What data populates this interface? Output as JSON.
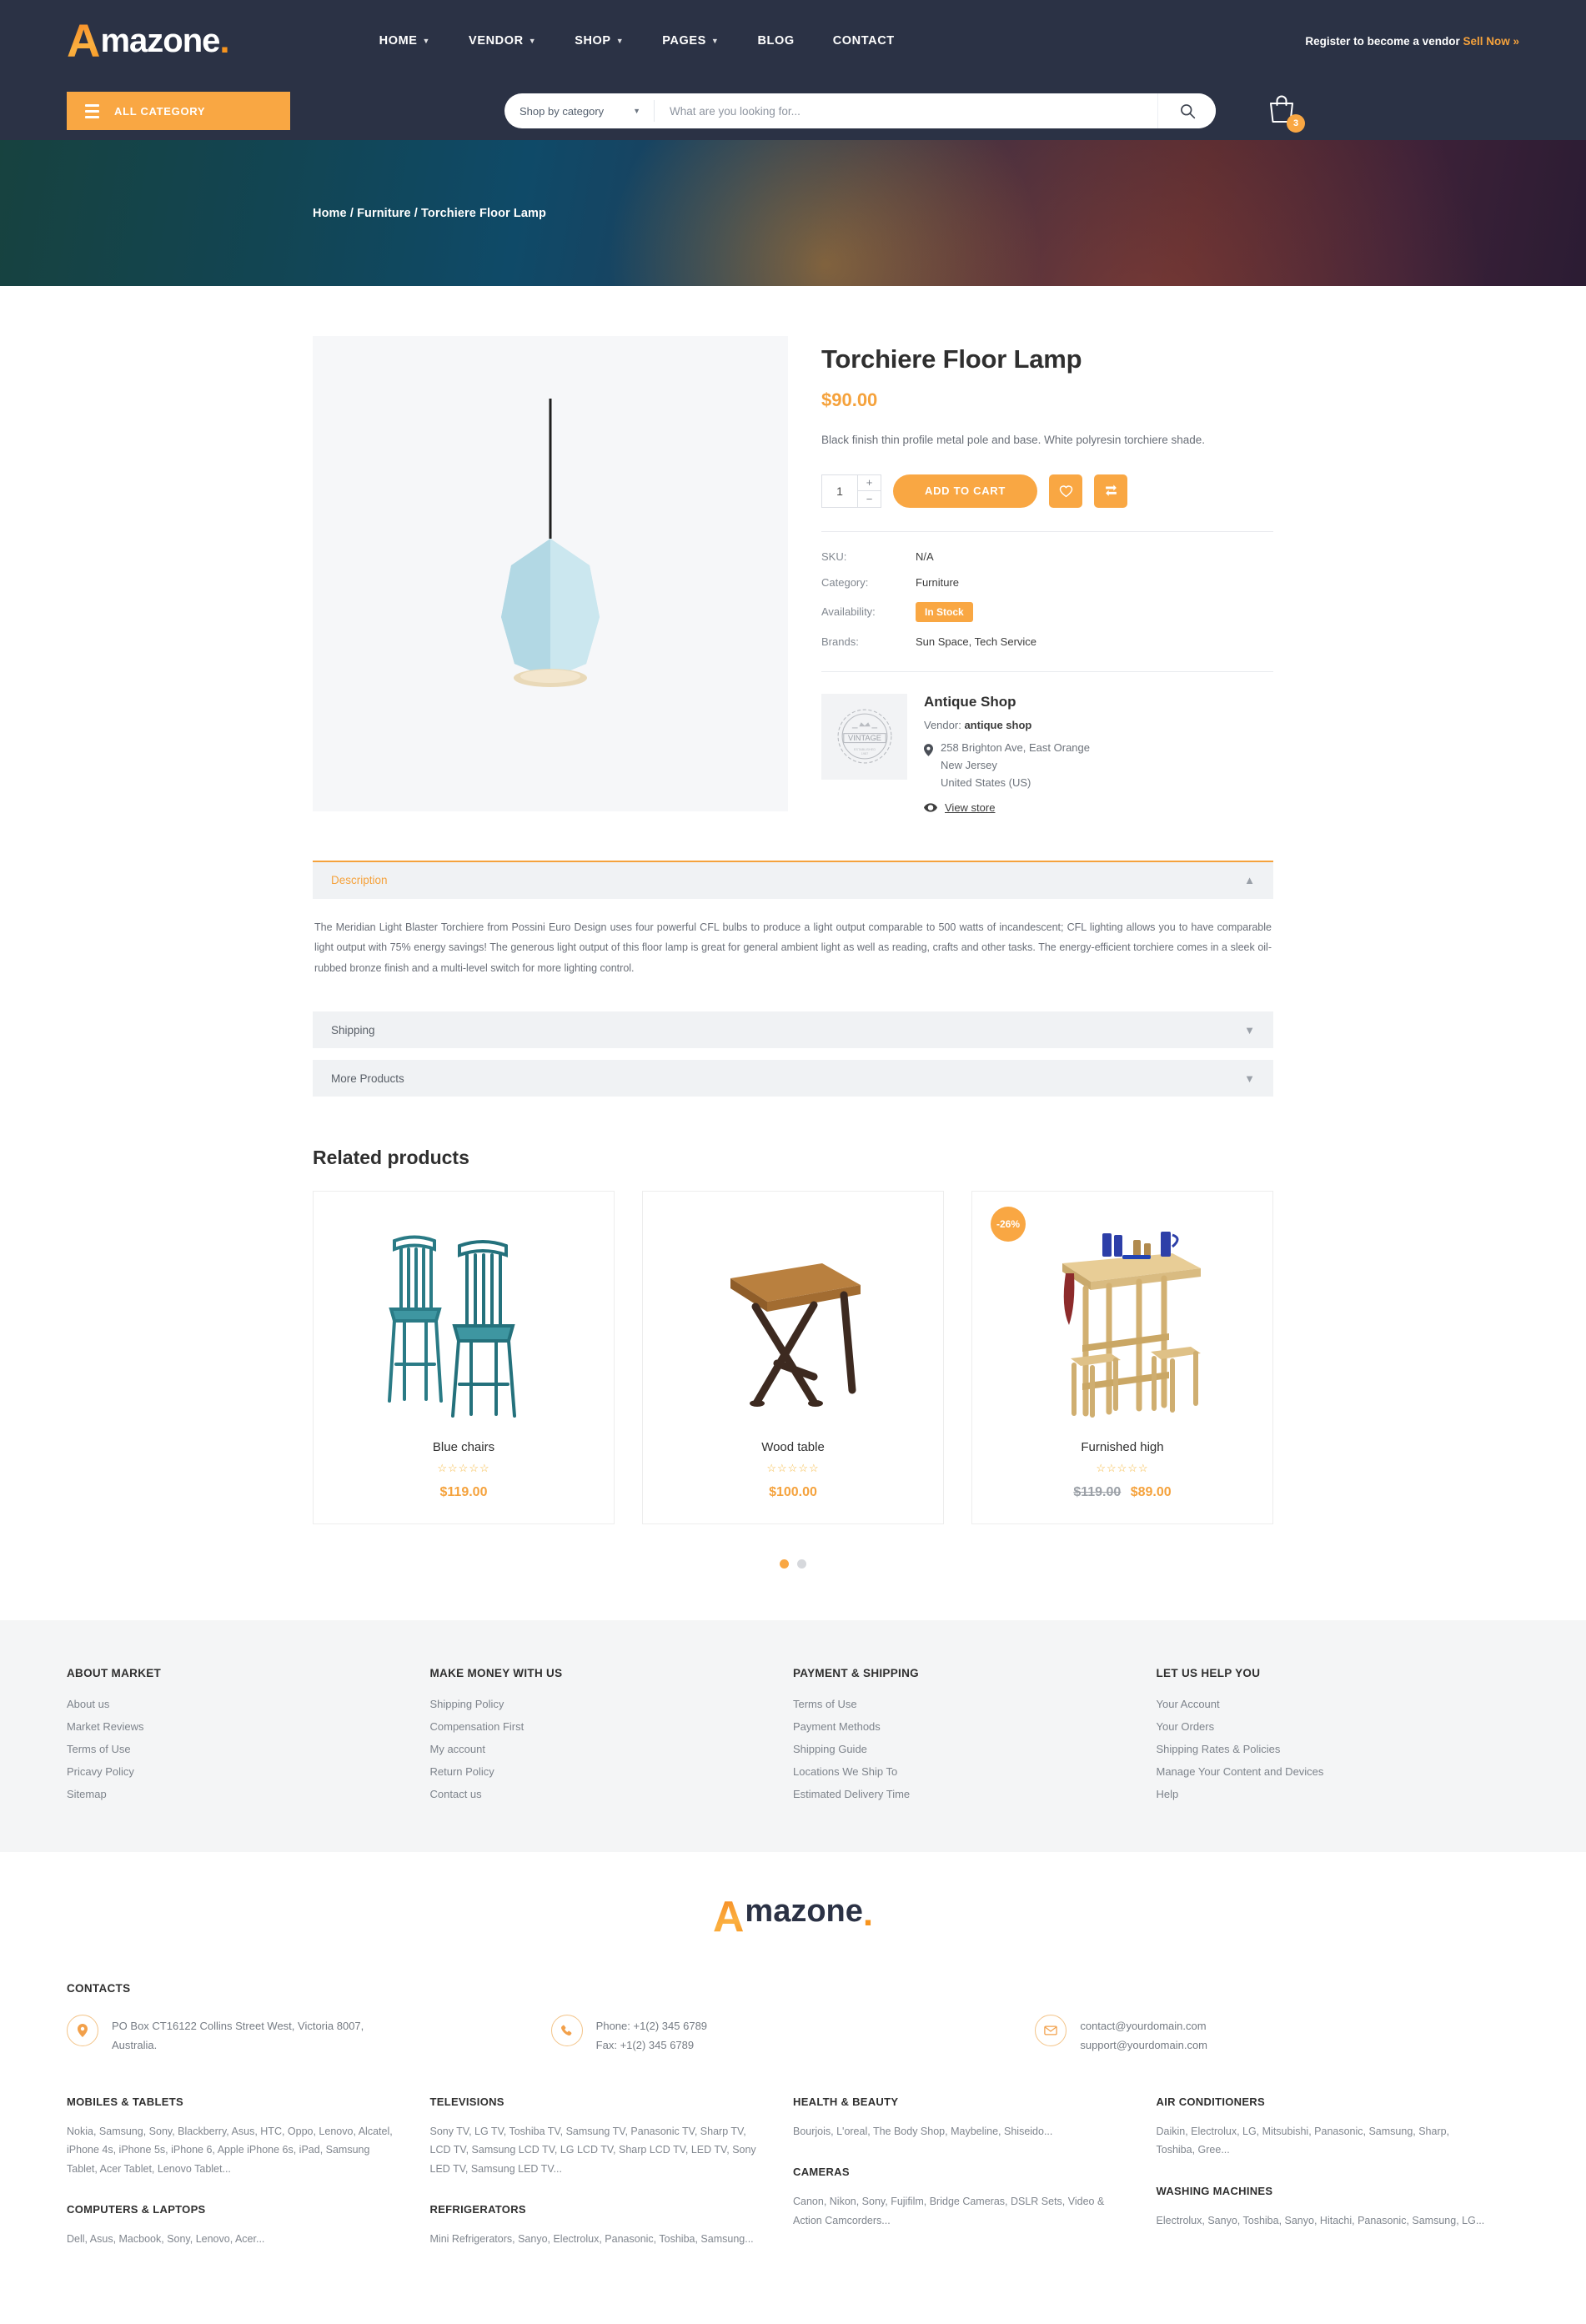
{
  "header": {
    "logo": {
      "letter": "A",
      "text": "mazone",
      "dot": "."
    },
    "nav": [
      {
        "label": "HOME",
        "caret": true
      },
      {
        "label": "VENDOR",
        "caret": true
      },
      {
        "label": "SHOP",
        "caret": true
      },
      {
        "label": "PAGES",
        "caret": true
      },
      {
        "label": "BLOG",
        "caret": false
      },
      {
        "label": "CONTACT",
        "caret": false
      }
    ],
    "register_text": "Register to become a vendor",
    "sell_now": "Sell Now »",
    "all_category": "ALL CATEGORY",
    "search": {
      "category_label": "Shop by category",
      "placeholder": "What are you looking for...",
      "value": ""
    },
    "cart_count": "3"
  },
  "banner": {
    "breadcrumb": "Home / Furniture / Torchiere Floor Lamp"
  },
  "product": {
    "title": "Torchiere Floor Lamp",
    "price": "$90.00",
    "short_description": "Black finish thin profile metal pole and base. White polyresin torchiere shade.",
    "quantity": "1",
    "add_to_cart": "ADD TO CART",
    "meta": [
      {
        "label": "SKU:",
        "value": "N/A",
        "type": "text"
      },
      {
        "label": "Category:",
        "value": "Furniture",
        "type": "text"
      },
      {
        "label": "Availability:",
        "value": "In Stock",
        "type": "badge"
      },
      {
        "label": "Brands:",
        "value": "Sun Space, Tech Service",
        "type": "text"
      }
    ]
  },
  "vendor": {
    "logo_text": "VINTAGE",
    "logo_sub": "ESTABLISHED 1987",
    "name": "Antique Shop",
    "vendor_label": "Vendor:",
    "vendor_name": "antique shop",
    "address_line1": "258 Brighton Ave, East Orange",
    "address_line2": "New Jersey",
    "address_line3": "United States (US)",
    "view_store": "View store"
  },
  "accordions": [
    {
      "title": "Description",
      "open": true,
      "body": "The Meridian Light Blaster Torchiere from Possini Euro Design uses four powerful CFL bulbs to produce a light output comparable to 500 watts of incandescent; CFL lighting allows you to have comparable light output with 75% energy savings! The generous light output of this floor lamp is great for general ambient light as well as reading, crafts and other tasks. The energy-efficient torchiere comes in a sleek oil-rubbed bronze finish and a multi-level switch for more lighting control."
    },
    {
      "title": "Shipping",
      "open": false,
      "body": ""
    },
    {
      "title": "More Products",
      "open": false,
      "body": ""
    }
  ],
  "related": {
    "heading": "Related products",
    "products": [
      {
        "name": "Blue chairs",
        "stars": "☆☆☆☆☆",
        "price": "$119.00",
        "old_price": "",
        "badge": ""
      },
      {
        "name": "Wood table",
        "stars": "☆☆☆☆☆",
        "price": "$100.00",
        "old_price": "",
        "badge": ""
      },
      {
        "name": "Furnished high",
        "stars": "☆☆☆☆☆",
        "price": "$89.00",
        "old_price": "$119.00",
        "badge": "-26%"
      }
    ],
    "dots": [
      {
        "active": true
      },
      {
        "active": false
      }
    ]
  },
  "footer": {
    "columns": [
      {
        "title": "ABOUT MARKET",
        "links": [
          "About us",
          "Market Reviews",
          "Terms of Use",
          "Pricavy Policy",
          "Sitemap"
        ]
      },
      {
        "title": "MAKE MONEY WITH US",
        "links": [
          "Shipping Policy",
          "Compensation First",
          "My account",
          "Return Policy",
          "Contact us"
        ]
      },
      {
        "title": "PAYMENT & SHIPPING",
        "links": [
          "Terms of Use",
          "Payment Methods",
          "Shipping Guide",
          "Locations We Ship To",
          "Estimated Delivery Time"
        ]
      },
      {
        "title": "LET US HELP YOU",
        "links": [
          "Your Account",
          "Your Orders",
          "Shipping Rates & Policies",
          "Manage Your Content and Devices",
          "Help"
        ]
      }
    ],
    "contacts_title": "CONTACTS",
    "contacts": [
      {
        "icon": "location-pin-icon",
        "lines": [
          "PO Box CT16122 Collins Street West, Victoria 8007,",
          "Australia."
        ]
      },
      {
        "icon": "phone-icon",
        "lines": [
          "Phone: +1(2) 345 6789",
          "Fax: +1(2) 345 6789"
        ]
      },
      {
        "icon": "mail-icon",
        "lines": [
          "contact@yourdomain.com",
          "support@yourdomain.com"
        ]
      }
    ],
    "categories": [
      [
        {
          "title": "MOBILES & TABLETS",
          "text": "Nokia, Samsung, Sony, Blackberry, Asus, HTC, Oppo, Lenovo, Alcatel, iPhone 4s, iPhone 5s, iPhone 6, Apple iPhone 6s, iPad, Samsung Tablet, Acer Tablet, Lenovo Tablet..."
        },
        {
          "title": "COMPUTERS & LAPTOPS",
          "text": "Dell, Asus, Macbook, Sony, Lenovo, Acer..."
        }
      ],
      [
        {
          "title": "TELEVISIONS",
          "text": "Sony TV, LG TV, Toshiba TV, Samsung TV, Panasonic TV, Sharp TV, LCD TV, Samsung LCD TV, LG LCD TV, Sharp LCD TV, LED TV, Sony LED TV, Samsung LED TV..."
        },
        {
          "title": "REFRIGERATORS",
          "text": "Mini Refrigerators, Sanyo, Electrolux, Panasonic, Toshiba, Samsung..."
        }
      ],
      [
        {
          "title": "HEALTH & BEAUTY",
          "text": "Bourjois, L'oreal, The Body Shop, Maybeline, Shiseido..."
        },
        {
          "title": "CAMERAS",
          "text": "Canon, Nikon, Sony, Fujifilm, Bridge Cameras, DSLR Sets, Video & Action Camcorders..."
        }
      ],
      [
        {
          "title": "AIR CONDITIONERS",
          "text": "Daikin, Electrolux, LG, Mitsubishi, Panasonic, Samsung, Sharp, Toshiba, Gree..."
        },
        {
          "title": "WASHING MACHINES",
          "text": "Electrolux, Sanyo, Toshiba, Sanyo, Hitachi, Panasonic, Samsung, LG..."
        }
      ]
    ]
  },
  "colors": {
    "accent": "#f9a743",
    "header_bg": "#2b3245",
    "text": "#3a3a3a"
  }
}
